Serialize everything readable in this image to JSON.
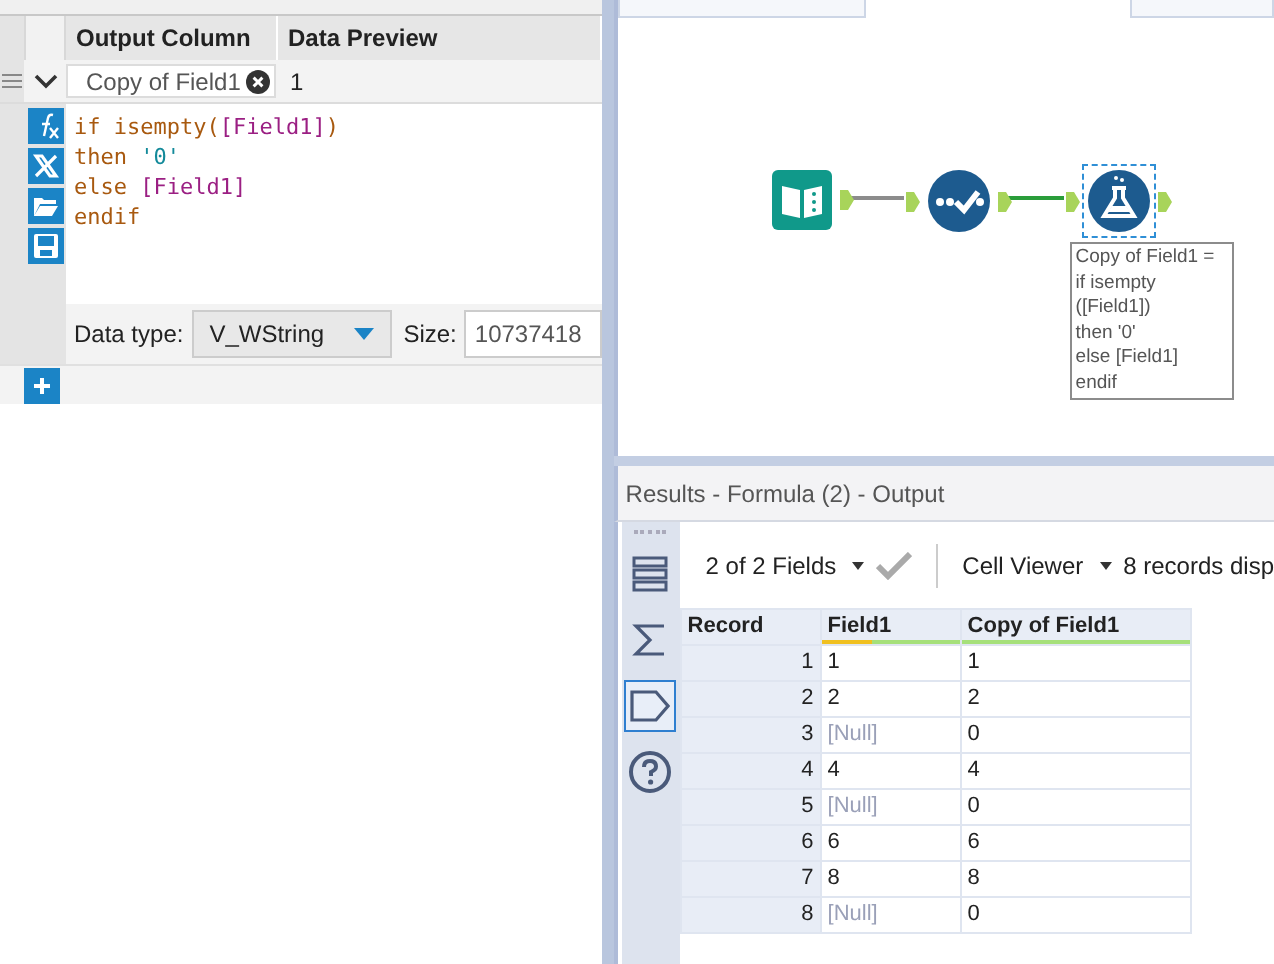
{
  "formula_editor": {
    "headers": [
      "Output Column",
      "Data Preview"
    ],
    "expanded": true,
    "output_column": "Copy of Field1",
    "preview": "1",
    "tools": [
      {
        "kind": "function"
      },
      {
        "kind": "variable"
      },
      {
        "kind": "open"
      },
      {
        "kind": "save"
      }
    ],
    "code_lines": [
      [
        {
          "kind": "keyword",
          "text": "if isempty("
        },
        {
          "kind": "field",
          "text": "[Field1]"
        },
        {
          "kind": "keyword",
          "text": ")"
        }
      ],
      [
        {
          "kind": "keyword",
          "text": "then "
        },
        {
          "kind": "string",
          "text": "'0'"
        }
      ],
      [
        {
          "kind": "keyword",
          "text": "else "
        },
        {
          "kind": "field",
          "text": "[Field1]"
        }
      ],
      [
        {
          "kind": "keyword",
          "text": "endif"
        }
      ]
    ],
    "data_type_label": "Data type:",
    "data_type": "V_WString",
    "size_label": "Size:",
    "size": "10737418"
  },
  "canvas": {
    "nodes": [
      {
        "kind": "input",
        "selected": false
      },
      {
        "kind": "select",
        "selected": false
      },
      {
        "kind": "formula",
        "selected": true
      }
    ],
    "connections": [
      {
        "color": "#8c8c8c"
      },
      {
        "color": "#2a9d3a"
      }
    ],
    "annotation": [
      "Copy of Field1 =",
      "if isempty",
      "([Field1])",
      "then '0'",
      "else [Field1]",
      "endif"
    ]
  },
  "results": {
    "title": "Results - Formula (2) - Output",
    "side_tools": [
      {
        "kind": "list",
        "selected": false
      },
      {
        "kind": "sum",
        "selected": false
      },
      {
        "kind": "tag",
        "selected": true
      },
      {
        "kind": "help",
        "selected": false
      }
    ],
    "fields_dropdown": "2 of 2 Fields",
    "cell_viewer": "Cell Viewer",
    "records_text": "8 records disp",
    "columns": [
      {
        "name": "Record"
      },
      {
        "name": "Field1"
      },
      {
        "name": "Copy of Field1"
      }
    ],
    "rows": [
      {
        "cells": [
          {
            "text": "1",
            "null": false
          },
          {
            "text": "1",
            "null": false
          },
          {
            "text": "1",
            "null": false
          }
        ]
      },
      {
        "cells": [
          {
            "text": "2",
            "null": false
          },
          {
            "text": "2",
            "null": false
          },
          {
            "text": "2",
            "null": false
          }
        ]
      },
      {
        "cells": [
          {
            "text": "3",
            "null": false
          },
          {
            "text": "[Null]",
            "null": true
          },
          {
            "text": "0",
            "null": false
          }
        ]
      },
      {
        "cells": [
          {
            "text": "4",
            "null": false
          },
          {
            "text": "4",
            "null": false
          },
          {
            "text": "4",
            "null": false
          }
        ]
      },
      {
        "cells": [
          {
            "text": "5",
            "null": false
          },
          {
            "text": "[Null]",
            "null": true
          },
          {
            "text": "0",
            "null": false
          }
        ]
      },
      {
        "cells": [
          {
            "text": "6",
            "null": false
          },
          {
            "text": "6",
            "null": false
          },
          {
            "text": "6",
            "null": false
          }
        ]
      },
      {
        "cells": [
          {
            "text": "7",
            "null": false
          },
          {
            "text": "8",
            "null": false
          },
          {
            "text": "8",
            "null": false
          }
        ]
      },
      {
        "cells": [
          {
            "text": "8",
            "null": false
          },
          {
            "text": "[Null]",
            "null": true
          },
          {
            "text": "0",
            "null": false
          }
        ]
      }
    ]
  }
}
